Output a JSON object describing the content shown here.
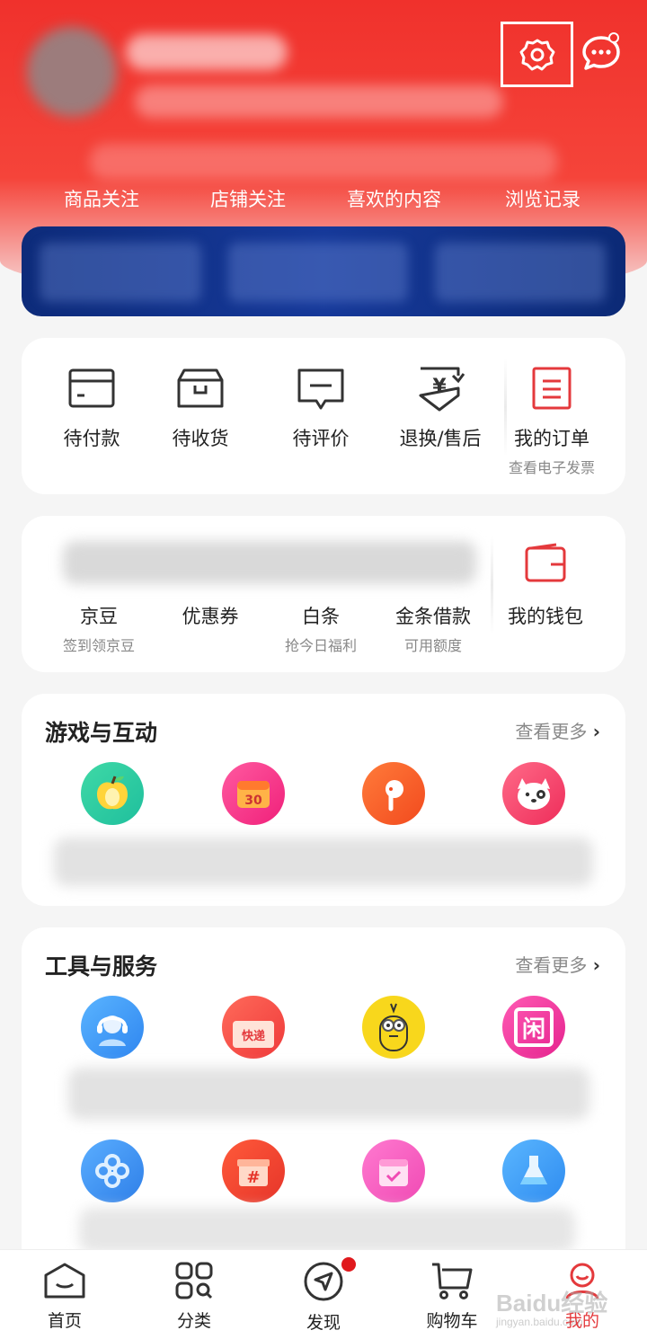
{
  "header": {
    "follow_items": [
      "商品关注",
      "店铺关注",
      "喜欢的内容",
      "浏览记录"
    ]
  },
  "orders": {
    "items": [
      {
        "label": "待付款"
      },
      {
        "label": "待收货"
      },
      {
        "label": "待评价"
      },
      {
        "label": "退换/售后"
      }
    ],
    "my_orders": {
      "label": "我的订单",
      "sub": "查看电子发票"
    }
  },
  "wallet": {
    "items": [
      {
        "label": "京豆",
        "sub": "签到领京豆"
      },
      {
        "label": "优惠券",
        "sub": ""
      },
      {
        "label": "白条",
        "sub": "抢今日福利"
      },
      {
        "label": "金条借款",
        "sub": "可用额度"
      }
    ],
    "my_wallet": {
      "label": "我的钱包"
    }
  },
  "games": {
    "title": "游戏与互动",
    "more": "查看更多",
    "icons": [
      "apple-icon",
      "calendar-30-icon",
      "bird-icon",
      "dog-icon"
    ]
  },
  "tools": {
    "title": "工具与服务",
    "more": "查看更多",
    "icons_row1": [
      "customer-service-icon",
      "express-icon",
      "minion-icon",
      "idle-icon"
    ],
    "icons_row2": [
      "link-icon",
      "gift-hash-icon",
      "calendar-check-icon",
      "flask-icon"
    ],
    "express_text": "快递",
    "idle_text": "闲"
  },
  "bottom_nav": [
    {
      "label": "首页"
    },
    {
      "label": "分类"
    },
    {
      "label": "发现"
    },
    {
      "label": "购物车"
    },
    {
      "label": "我的"
    }
  ],
  "watermark": {
    "main": "Baidu经验",
    "sub": "jingyan.baidu.com"
  },
  "colors": {
    "brand_red": "#f0312c",
    "banner_blue": "#0d2b7a"
  }
}
